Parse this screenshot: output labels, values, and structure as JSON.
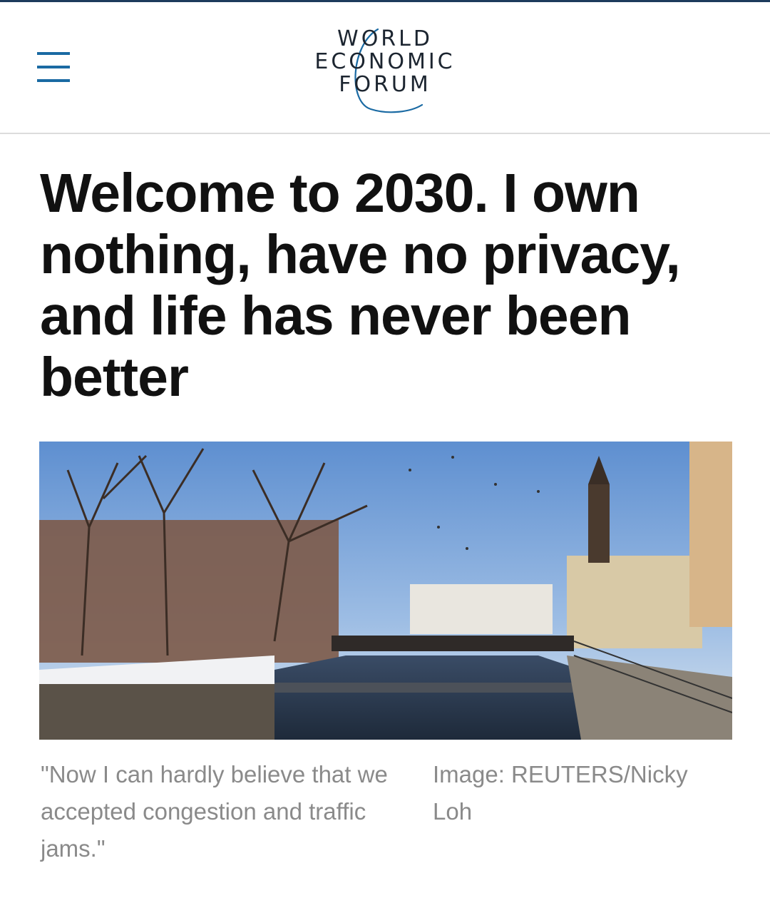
{
  "header": {
    "menu_icon": "hamburger-menu-icon",
    "logo": {
      "line1": "WORLD",
      "line2": "ECONOMIC",
      "line3": "FORUM"
    },
    "accent_color": "#1a6aa3"
  },
  "article": {
    "headline": "Welcome to 2030. I own nothing, have no privacy, and life has never been better",
    "image": {
      "caption": "\"Now I can hardly believe that we accepted congestion and traffic jams.\"",
      "credit": "Image: REUTERS/Nicky Loh"
    }
  }
}
